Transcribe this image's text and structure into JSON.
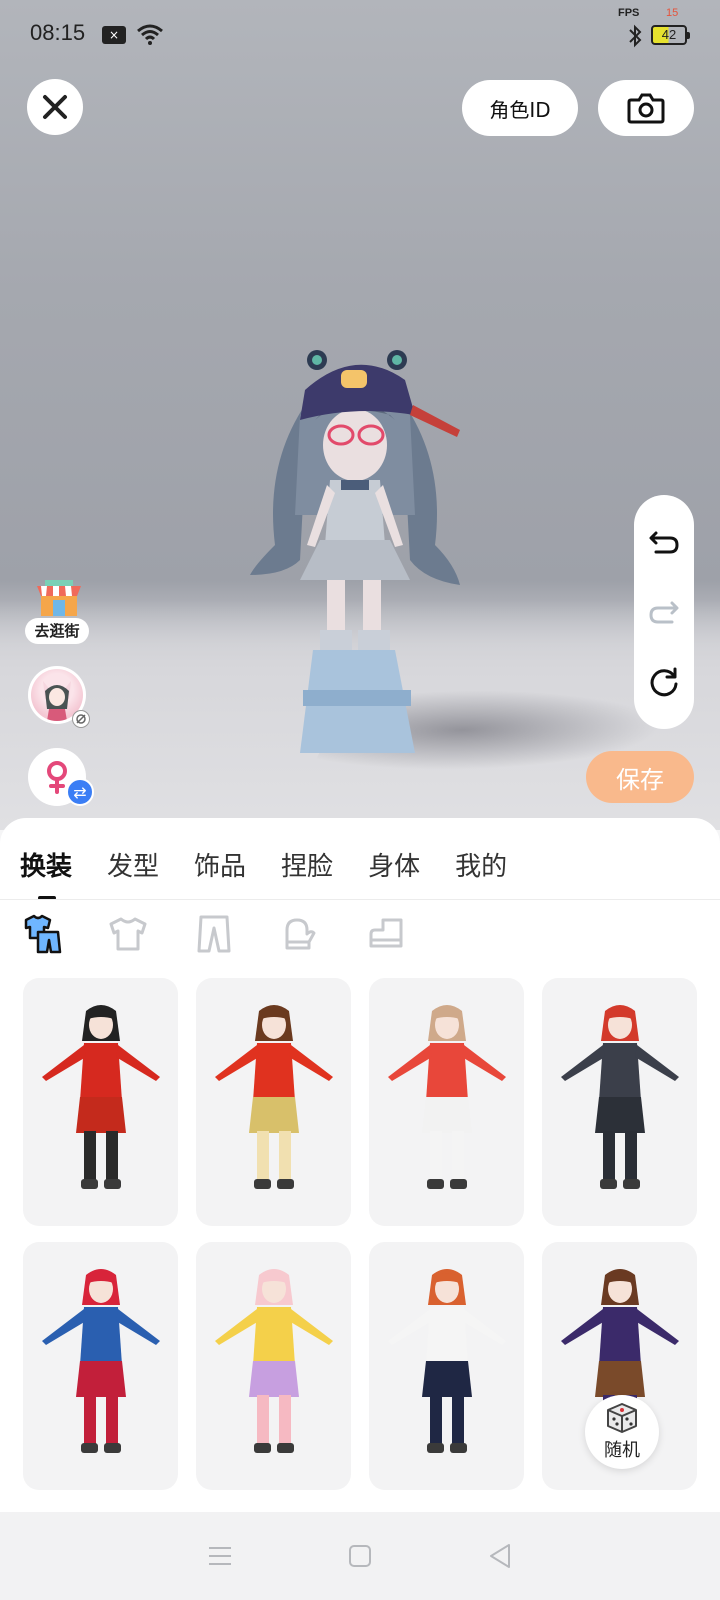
{
  "status_bar": {
    "time": "08:15",
    "fps_label": "FPS",
    "fps_value": "15",
    "battery": "42"
  },
  "top_bar": {
    "role_id_label": "角色ID",
    "close_icon": "close-icon",
    "camera_icon": "camera-icon"
  },
  "left_shortcuts": {
    "shop_label": "去逛街"
  },
  "edit_controls": {
    "undo": "undo-icon",
    "redo": "redo-icon",
    "reset": "reset-icon"
  },
  "save_label": "保存",
  "tabs": [
    {
      "label": "换装",
      "active": true
    },
    {
      "label": "发型",
      "active": false
    },
    {
      "label": "饰品",
      "active": false
    },
    {
      "label": "捏脸",
      "active": false
    },
    {
      "label": "身体",
      "active": false
    },
    {
      "label": "我的",
      "active": false
    }
  ],
  "subcategories": [
    {
      "icon": "outfit-set-icon",
      "active": true
    },
    {
      "icon": "top-shirt-icon",
      "active": false
    },
    {
      "icon": "pants-icon",
      "active": false
    },
    {
      "icon": "gloves-icon",
      "active": false
    },
    {
      "icon": "shoes-icon",
      "active": false
    }
  ],
  "outfits": [
    {
      "name": "red-chinese-dress-outfit",
      "colors": {
        "hair": "#222222",
        "top": "#d6291f",
        "bottom": "#c42a1c",
        "legs": "#2a2a2a"
      }
    },
    {
      "name": "red-coat-beret-outfit",
      "colors": {
        "hair": "#6b3a1f",
        "top": "#e0321f",
        "bottom": "#d8c06a",
        "legs": "#f1e0b0"
      }
    },
    {
      "name": "white-red-winter-outfit",
      "colors": {
        "hair": "#cfa98a",
        "top": "#e8473a",
        "bottom": "#f2f2f2",
        "legs": "#f4f4f4"
      }
    },
    {
      "name": "black-tactical-suit-outfit",
      "colors": {
        "hair": "#d33a2b",
        "top": "#3b3f4a",
        "bottom": "#2c3038",
        "legs": "#2a2e36"
      }
    },
    {
      "name": "blue-red-hero-suit-outfit",
      "colors": {
        "hair": "#d8243a",
        "top": "#2a5fb0",
        "bottom": "#c21f3a",
        "legs": "#c21f3a"
      }
    },
    {
      "name": "pink-cat-costume-outfit",
      "colors": {
        "hair": "#f7c9cf",
        "top": "#f4d04a",
        "bottom": "#c79fe0",
        "legs": "#f6b9c2"
      }
    },
    {
      "name": "white-tee-track-pants-outfit",
      "colors": {
        "hair": "#d9612f",
        "top": "#f5f5f5",
        "bottom": "#1f2744",
        "legs": "#1f2744"
      }
    },
    {
      "name": "purple-academy-robe-outfit",
      "colors": {
        "hair": "#6a3a22",
        "top": "#3b2a6a",
        "bottom": "#7a4a2a",
        "legs": "#3b2a6a"
      }
    }
  ],
  "random_label": "随机",
  "navbar": {
    "menu": "menu-icon",
    "home": "home-icon",
    "back": "back-icon"
  }
}
